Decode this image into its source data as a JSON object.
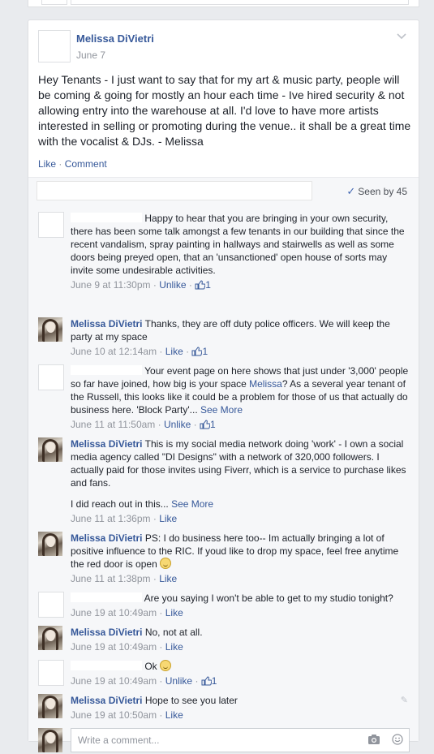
{
  "post": {
    "author": "Melissa DiVietri",
    "date": "June 7",
    "text": "Hey Tenants - I just want to say that for my art & music party, people will be coming & going for mostly an hour each time - Ive hired security & not allowing entry into the warehouse at all. I'd love to have more artists interested in selling or promoting during the venue.. it shall be a great time with the vocalist & DJs. - Melissa",
    "like_label": "Like",
    "separator": " · ",
    "comment_label": "Comment",
    "seen_by": "Seen by 45"
  },
  "comments": [
    {
      "author": "",
      "text": "Happy to hear that you are bringing in your own security, there has been some talk amongst a few tenants in our building that since the recent vandalism, spray painting in hallways and stairwells as well as some doors being preyed open, that an 'unsanctioned' open house of sorts may invite some undesirable activities.",
      "time": "June 9 at 11:30pm",
      "action": "Unlike",
      "likes": "1"
    },
    {
      "author": "Melissa DiVietri",
      "text": "Thanks, they are off duty police officers. We will keep the party at my space",
      "time": "June 10 at 12:14am",
      "action": "Like",
      "likes": "1"
    },
    {
      "author": "",
      "text_before": "Your event page on here shows that just under '3,000' people so far have joined, how big is your space ",
      "mention": "Melissa",
      "text_after": "? As a several year tenant of the Russell, this looks like it could be a problem for those of us that actually do business here. 'Block Party'... ",
      "see_more": "See More",
      "time": "June 11 at 11:50am",
      "action": "Unlike",
      "likes": "1"
    },
    {
      "author": "Melissa DiVietri",
      "text": "This is my social media network doing 'work' - I own a social media agency called \"DI Designs\" with a network of 320,000 followers. I actually paid for those invites using Fiverr, which is a service to purchase likes and fans.",
      "text2": "I did reach out in this... ",
      "see_more": "See More",
      "time": "June 11 at 1:36pm",
      "action": "Like"
    },
    {
      "author": "Melissa DiVietri",
      "text": "PS: I do business here too-- Im actually bringing a lot of positive influence to the RIC. If youd like to drop my space, feel free anytime the red door is open",
      "time": "June 11 at 1:38pm",
      "action": "Like"
    },
    {
      "author": "",
      "text": "Are you saying I won't be able to get to my studio tonight?",
      "time": "June 19 at 10:49am",
      "action": "Like"
    },
    {
      "author": "Melissa DiVietri",
      "text": "No, not at all.",
      "time": "June 19 at 10:49am",
      "action": "Like"
    },
    {
      "author": "",
      "text": "Ok",
      "time": "June 19 at 10:49am",
      "action": "Unlike",
      "likes": "1"
    },
    {
      "author": "Melissa DiVietri",
      "text": "Hope to see you later",
      "time": "June 19 at 10:50am",
      "action": "Like"
    }
  ],
  "composer": {
    "placeholder": "Write a comment..."
  },
  "colors": {
    "link": "#365899",
    "meta": "#90949c",
    "background": "#e9ebee",
    "comments_bg": "#f6f7f9"
  },
  "icons": [
    "chevron-down-icon",
    "check-icon",
    "thumbs-up-icon",
    "smiley-icon",
    "pencil-icon",
    "camera-icon",
    "emoji-icon"
  ]
}
